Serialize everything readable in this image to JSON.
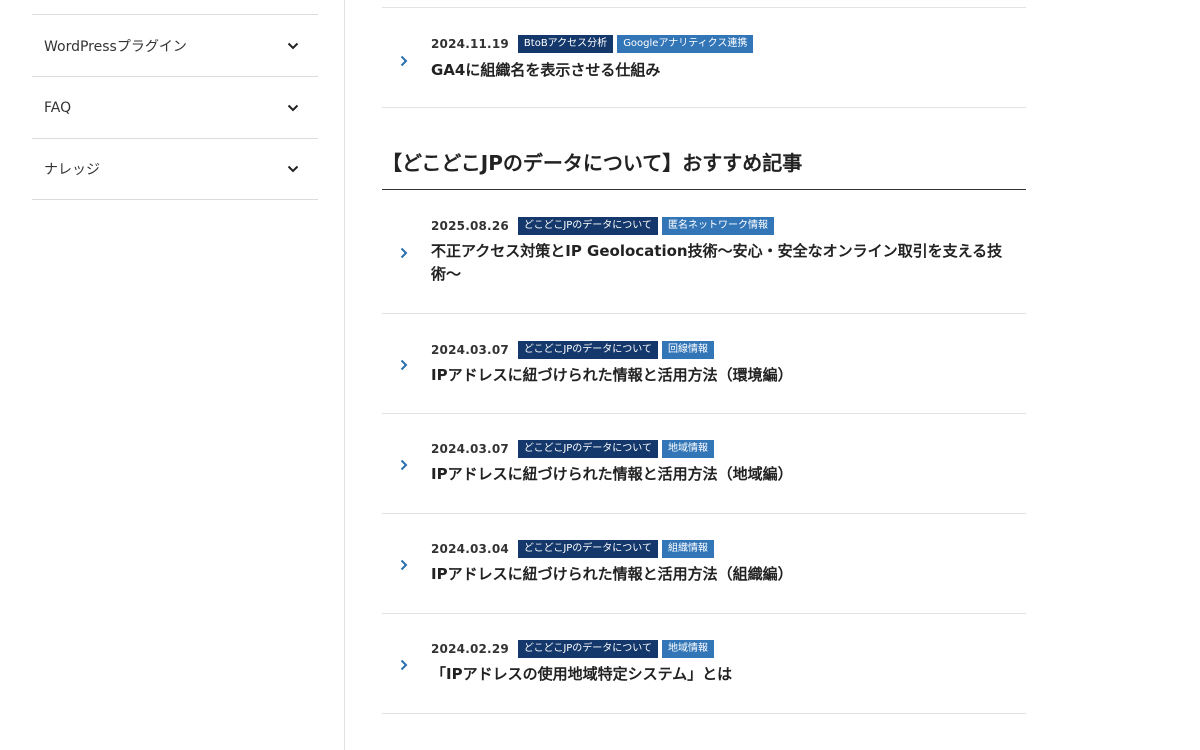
{
  "sidebar": {
    "items": [
      {
        "label": "WordPressプラグイン"
      },
      {
        "label": "FAQ"
      },
      {
        "label": "ナレッジ"
      }
    ]
  },
  "top_article": {
    "date": "2024.11.19",
    "tags": [
      "BtoBアクセス分析",
      "Googleアナリティクス連携"
    ],
    "title": "GA4に組織名を表示させる仕組み"
  },
  "section": {
    "heading": "【どこどこJPのデータについて】おすすめ記事"
  },
  "articles": [
    {
      "date": "2025.08.26",
      "tags": [
        "どこどこJPのデータについて",
        "匿名ネットワーク情報"
      ],
      "title": "不正アクセス対策とIP Geolocation技術〜安心・安全なオンライン取引を支える技術〜"
    },
    {
      "date": "2024.03.07",
      "tags": [
        "どこどこJPのデータについて",
        "回線情報"
      ],
      "title": "IPアドレスに紐づけられた情報と活用方法（環境編）"
    },
    {
      "date": "2024.03.07",
      "tags": [
        "どこどこJPのデータについて",
        "地域情報"
      ],
      "title": "IPアドレスに紐づけられた情報と活用方法（地域編）"
    },
    {
      "date": "2024.03.04",
      "tags": [
        "どこどこJPのデータについて",
        "組織情報"
      ],
      "title": "IPアドレスに紐づけられた情報と活用方法（組織編）"
    },
    {
      "date": "2024.02.29",
      "tags": [
        "どこどこJPのデータについて",
        "地域情報"
      ],
      "title": "「IPアドレスの使用地域特定システム」とは"
    }
  ],
  "colors": {
    "tag_dark": "#14386b",
    "tag_light": "#3376b8",
    "arrow": "#2a6fb0"
  },
  "icons": {
    "sidebar_toggle": "chevron-down-icon",
    "article_link": "chevron-right-icon"
  }
}
